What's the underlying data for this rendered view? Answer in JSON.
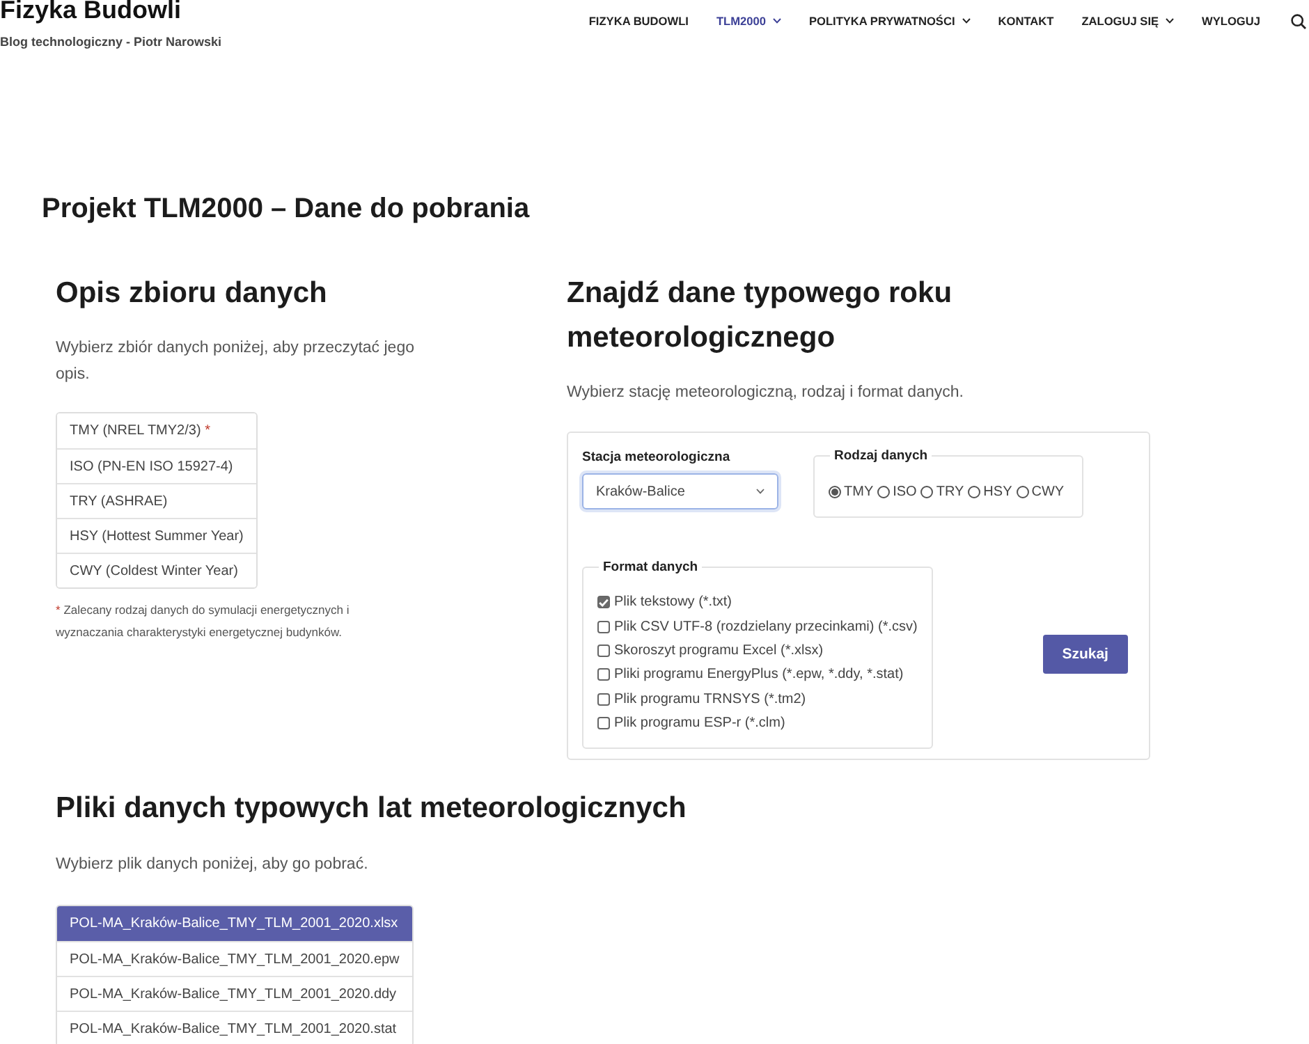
{
  "site": {
    "title": "Fizyka Budowli",
    "tagline": "Blog technologiczny - Piotr Narowski"
  },
  "nav": {
    "items": [
      {
        "label": "FIZYKA BUDOWLI",
        "selected": false,
        "has_submenu": false
      },
      {
        "label": "TLM2000",
        "selected": true,
        "has_submenu": true
      },
      {
        "label": "POLITYKA PRYWATNOŚCI",
        "selected": false,
        "has_submenu": true
      },
      {
        "label": "KONTAKT",
        "selected": false,
        "has_submenu": false
      },
      {
        "label": "ZALOGUJ SIĘ",
        "selected": false,
        "has_submenu": true
      },
      {
        "label": "WYLOGUJ",
        "selected": false,
        "has_submenu": false
      }
    ]
  },
  "page_title": "Projekt TLM2000 – Dane do pobrania",
  "description": {
    "heading": "Opis zbioru danych",
    "intro": "Wybierz zbiór danych poniżej, aby przeczytać jego opis.",
    "datasets": [
      {
        "label": "TMY (NREL TMY2/3)",
        "mark": "*",
        "selected": false
      },
      {
        "label": "ISO (PN-EN ISO 15927-4)",
        "selected": false
      },
      {
        "label": "TRY (ASHRAE)",
        "selected": false
      },
      {
        "label": "HSY (Hottest Summer Year)",
        "selected": false
      },
      {
        "label": "CWY (Coldest Winter Year)",
        "selected": false
      }
    ],
    "footnote": {
      "mark": "*",
      "text": "Zalecany rodzaj danych do symulacji energetycznych i wyznaczania charakterystyki energetycznej budynków."
    }
  },
  "search_form": {
    "heading": "Znajdź dane typowego roku meteorologicznego",
    "intro": "Wybierz stację meteorologiczną, rodzaj i format danych.",
    "station": {
      "label": "Stacja meteorologiczna",
      "value": "Kraków-Balice",
      "focused": true
    },
    "data_type": {
      "legend": "Rodzaj danych",
      "options": [
        {
          "label": "TMY",
          "selected": true
        },
        {
          "label": "ISO",
          "selected": false
        },
        {
          "label": "TRY",
          "selected": false
        },
        {
          "label": "HSY",
          "selected": false
        },
        {
          "label": "CWY",
          "selected": false
        }
      ]
    },
    "format": {
      "legend": "Format danych",
      "options": [
        {
          "label": "Plik tekstowy (*.txt)",
          "checked": true
        },
        {
          "label": "Plik CSV UTF-8 (rozdzielany przecinkami) (*.csv)",
          "checked": false
        },
        {
          "label": "Skoroszyt programu Excel (*.xlsx)",
          "checked": false
        },
        {
          "label": "Pliki programu EnergyPlus (*.epw, *.ddy, *.stat)",
          "checked": false
        },
        {
          "label": "Plik programu TRNSYS (*.tm2)",
          "checked": false
        },
        {
          "label": "Plik programu ESP-r (*.clm)",
          "checked": false
        }
      ]
    },
    "button": "Szukaj"
  },
  "files": {
    "heading": "Pliki danych typowych lat meteorologicznych",
    "intro": "Wybierz plik danych poniżej, aby go pobrać.",
    "items": [
      {
        "name": "POL-MA_Kraków-Balice_TMY_TLM_2001_2020.xlsx",
        "selected": true
      },
      {
        "name": "POL-MA_Kraków-Balice_TMY_TLM_2001_2020.epw",
        "selected": false
      },
      {
        "name": "POL-MA_Kraków-Balice_TMY_TLM_2001_2020.ddy",
        "selected": false
      },
      {
        "name": "POL-MA_Kraków-Balice_TMY_TLM_2001_2020.stat",
        "selected": false
      }
    ]
  }
}
